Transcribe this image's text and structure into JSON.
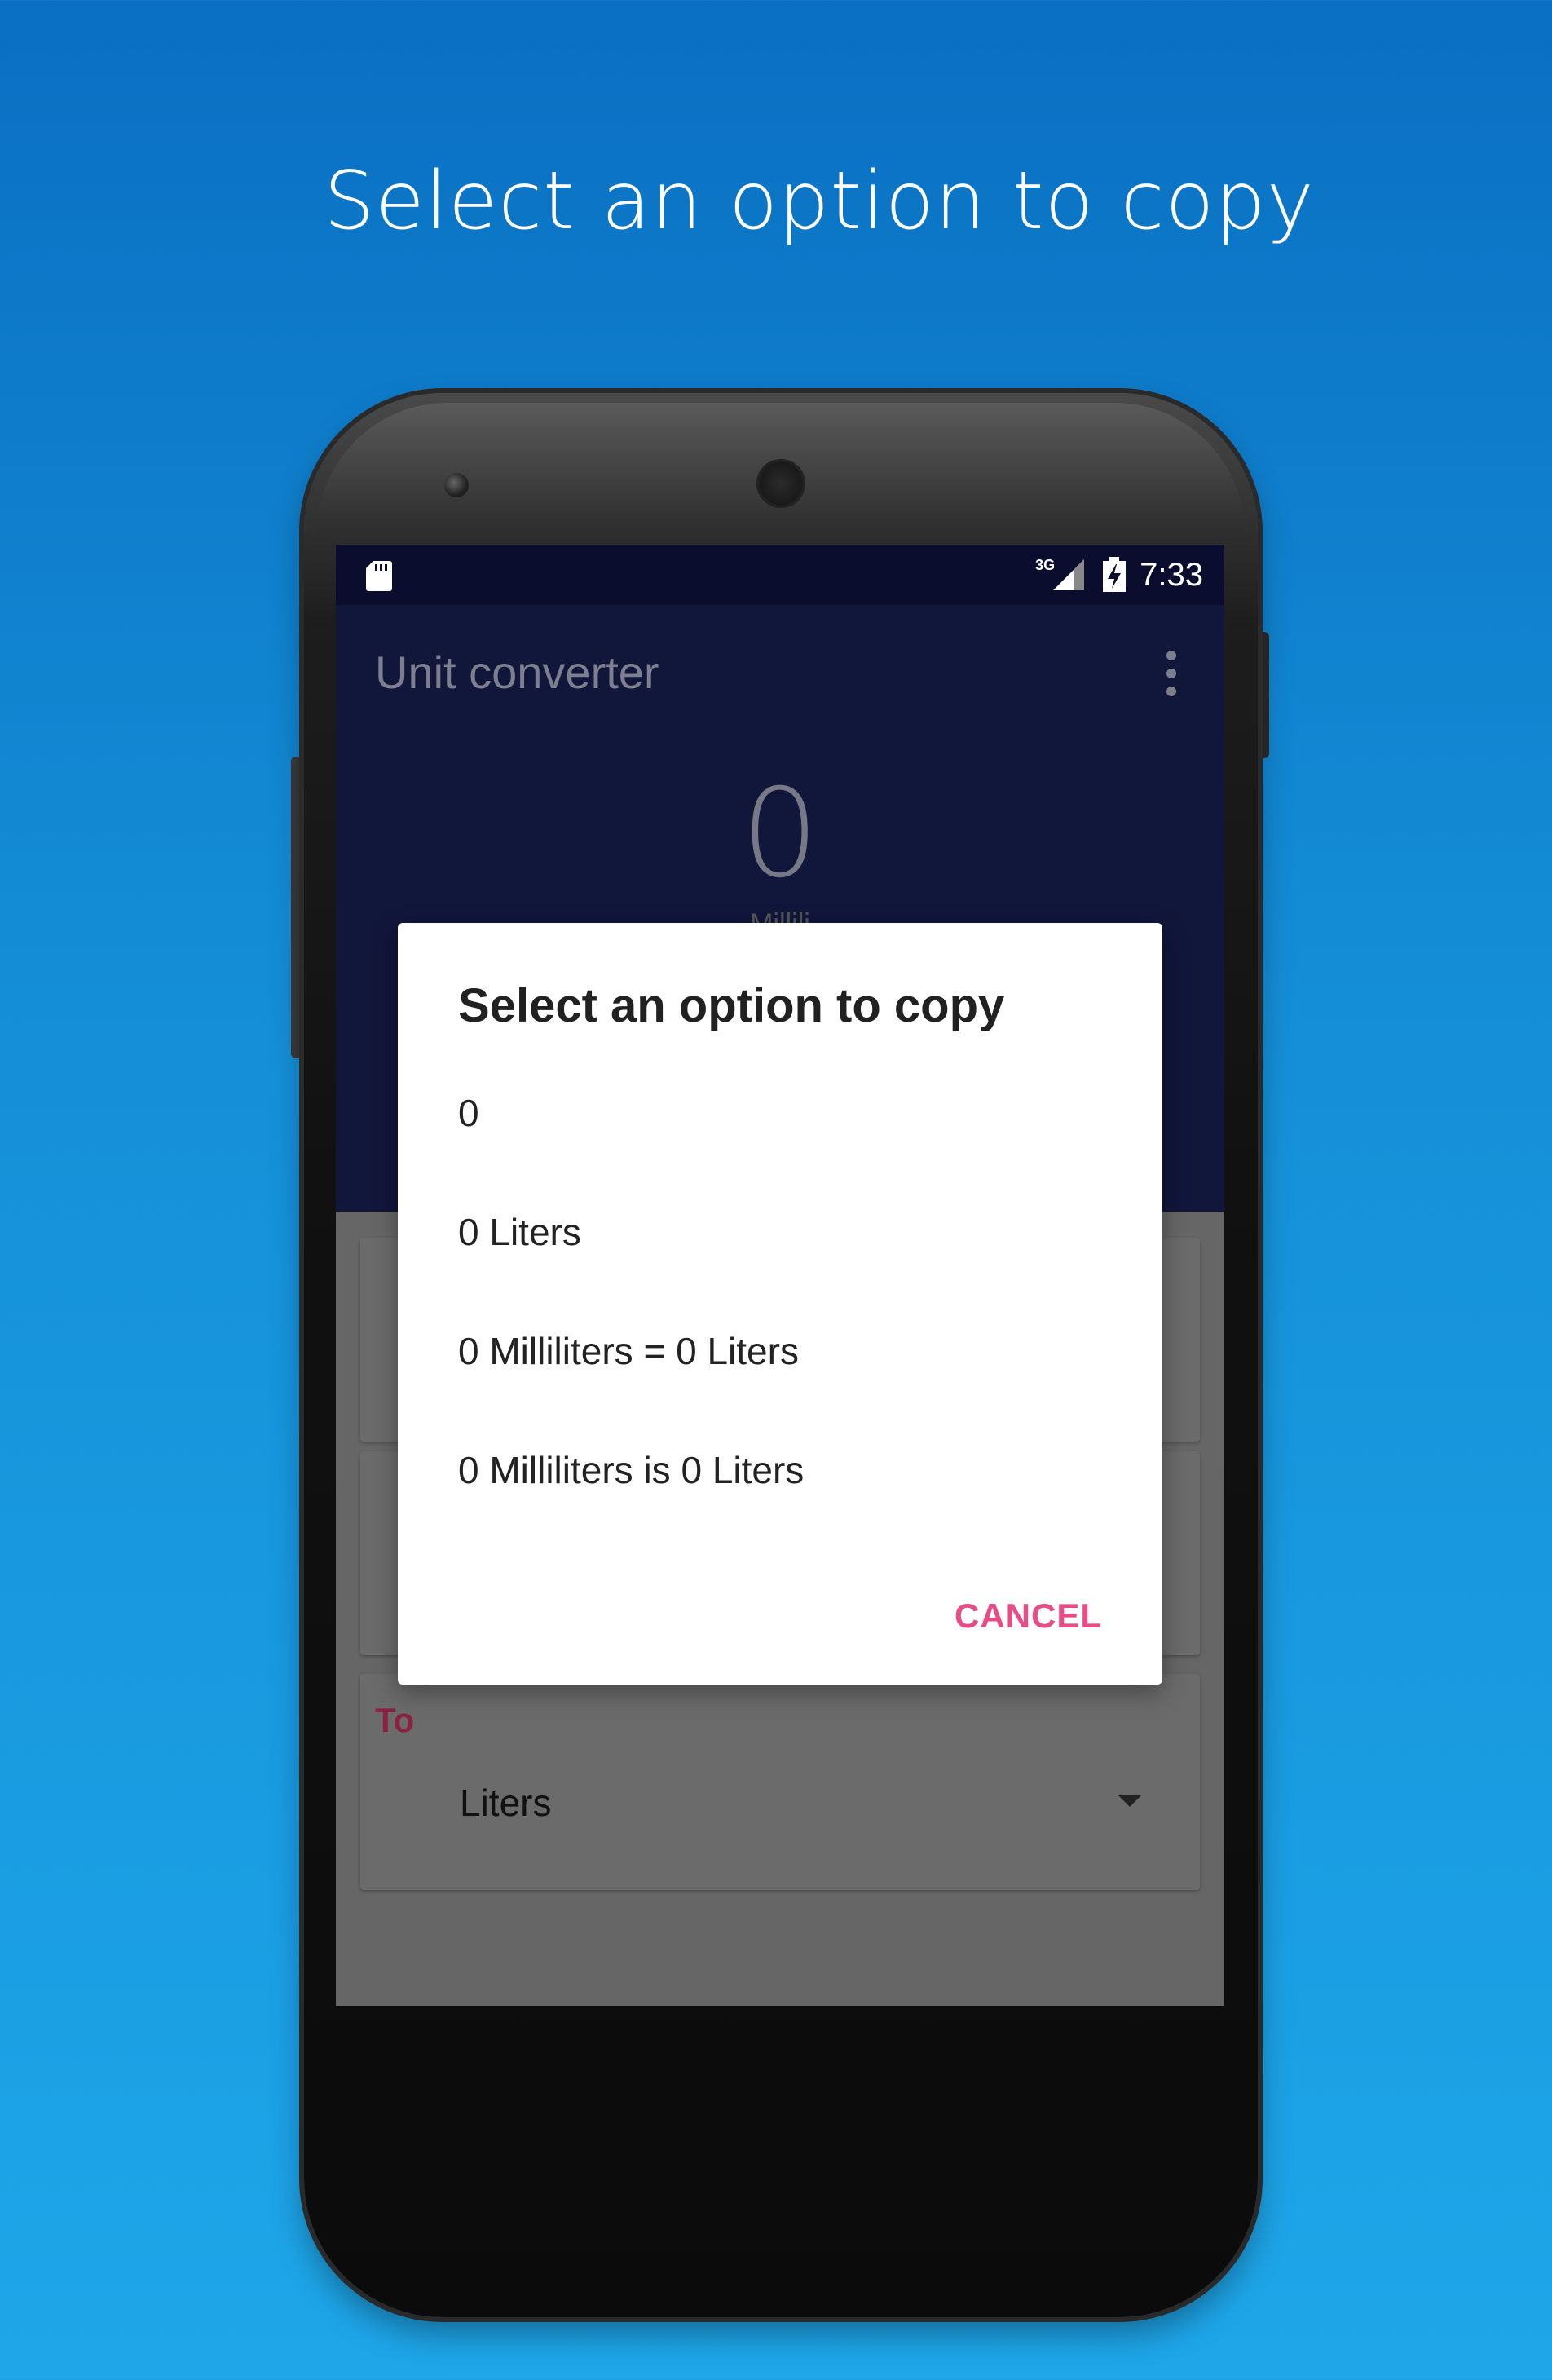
{
  "headline": "Select an option to copy",
  "status_bar": {
    "network": "3G",
    "time": "7:33"
  },
  "app_bar": {
    "title": "Unit converter"
  },
  "hero": {
    "value": "0",
    "unit_partial": "Millili"
  },
  "to_card": {
    "label": "To",
    "value": "Liters"
  },
  "dialog": {
    "title": "Select an option to copy",
    "options": [
      "0",
      "0 Liters",
      "0 Milliliters = 0 Liters",
      "0 Milliliters is 0 Liters"
    ],
    "cancel_label": "CANCEL"
  },
  "colors": {
    "accent": "#e84b86",
    "to_label": "#8b2244",
    "status_bar_bg": "#0b0d2e",
    "app_bar_bg": "#11163b"
  },
  "icons": {
    "sd_card": "sd-card-icon",
    "signal": "signal-icon",
    "battery": "battery-icon",
    "overflow": "more-vert-icon",
    "back": "back-icon",
    "home": "home-icon",
    "recents": "recents-icon",
    "dropdown": "dropdown-arrow-icon"
  }
}
